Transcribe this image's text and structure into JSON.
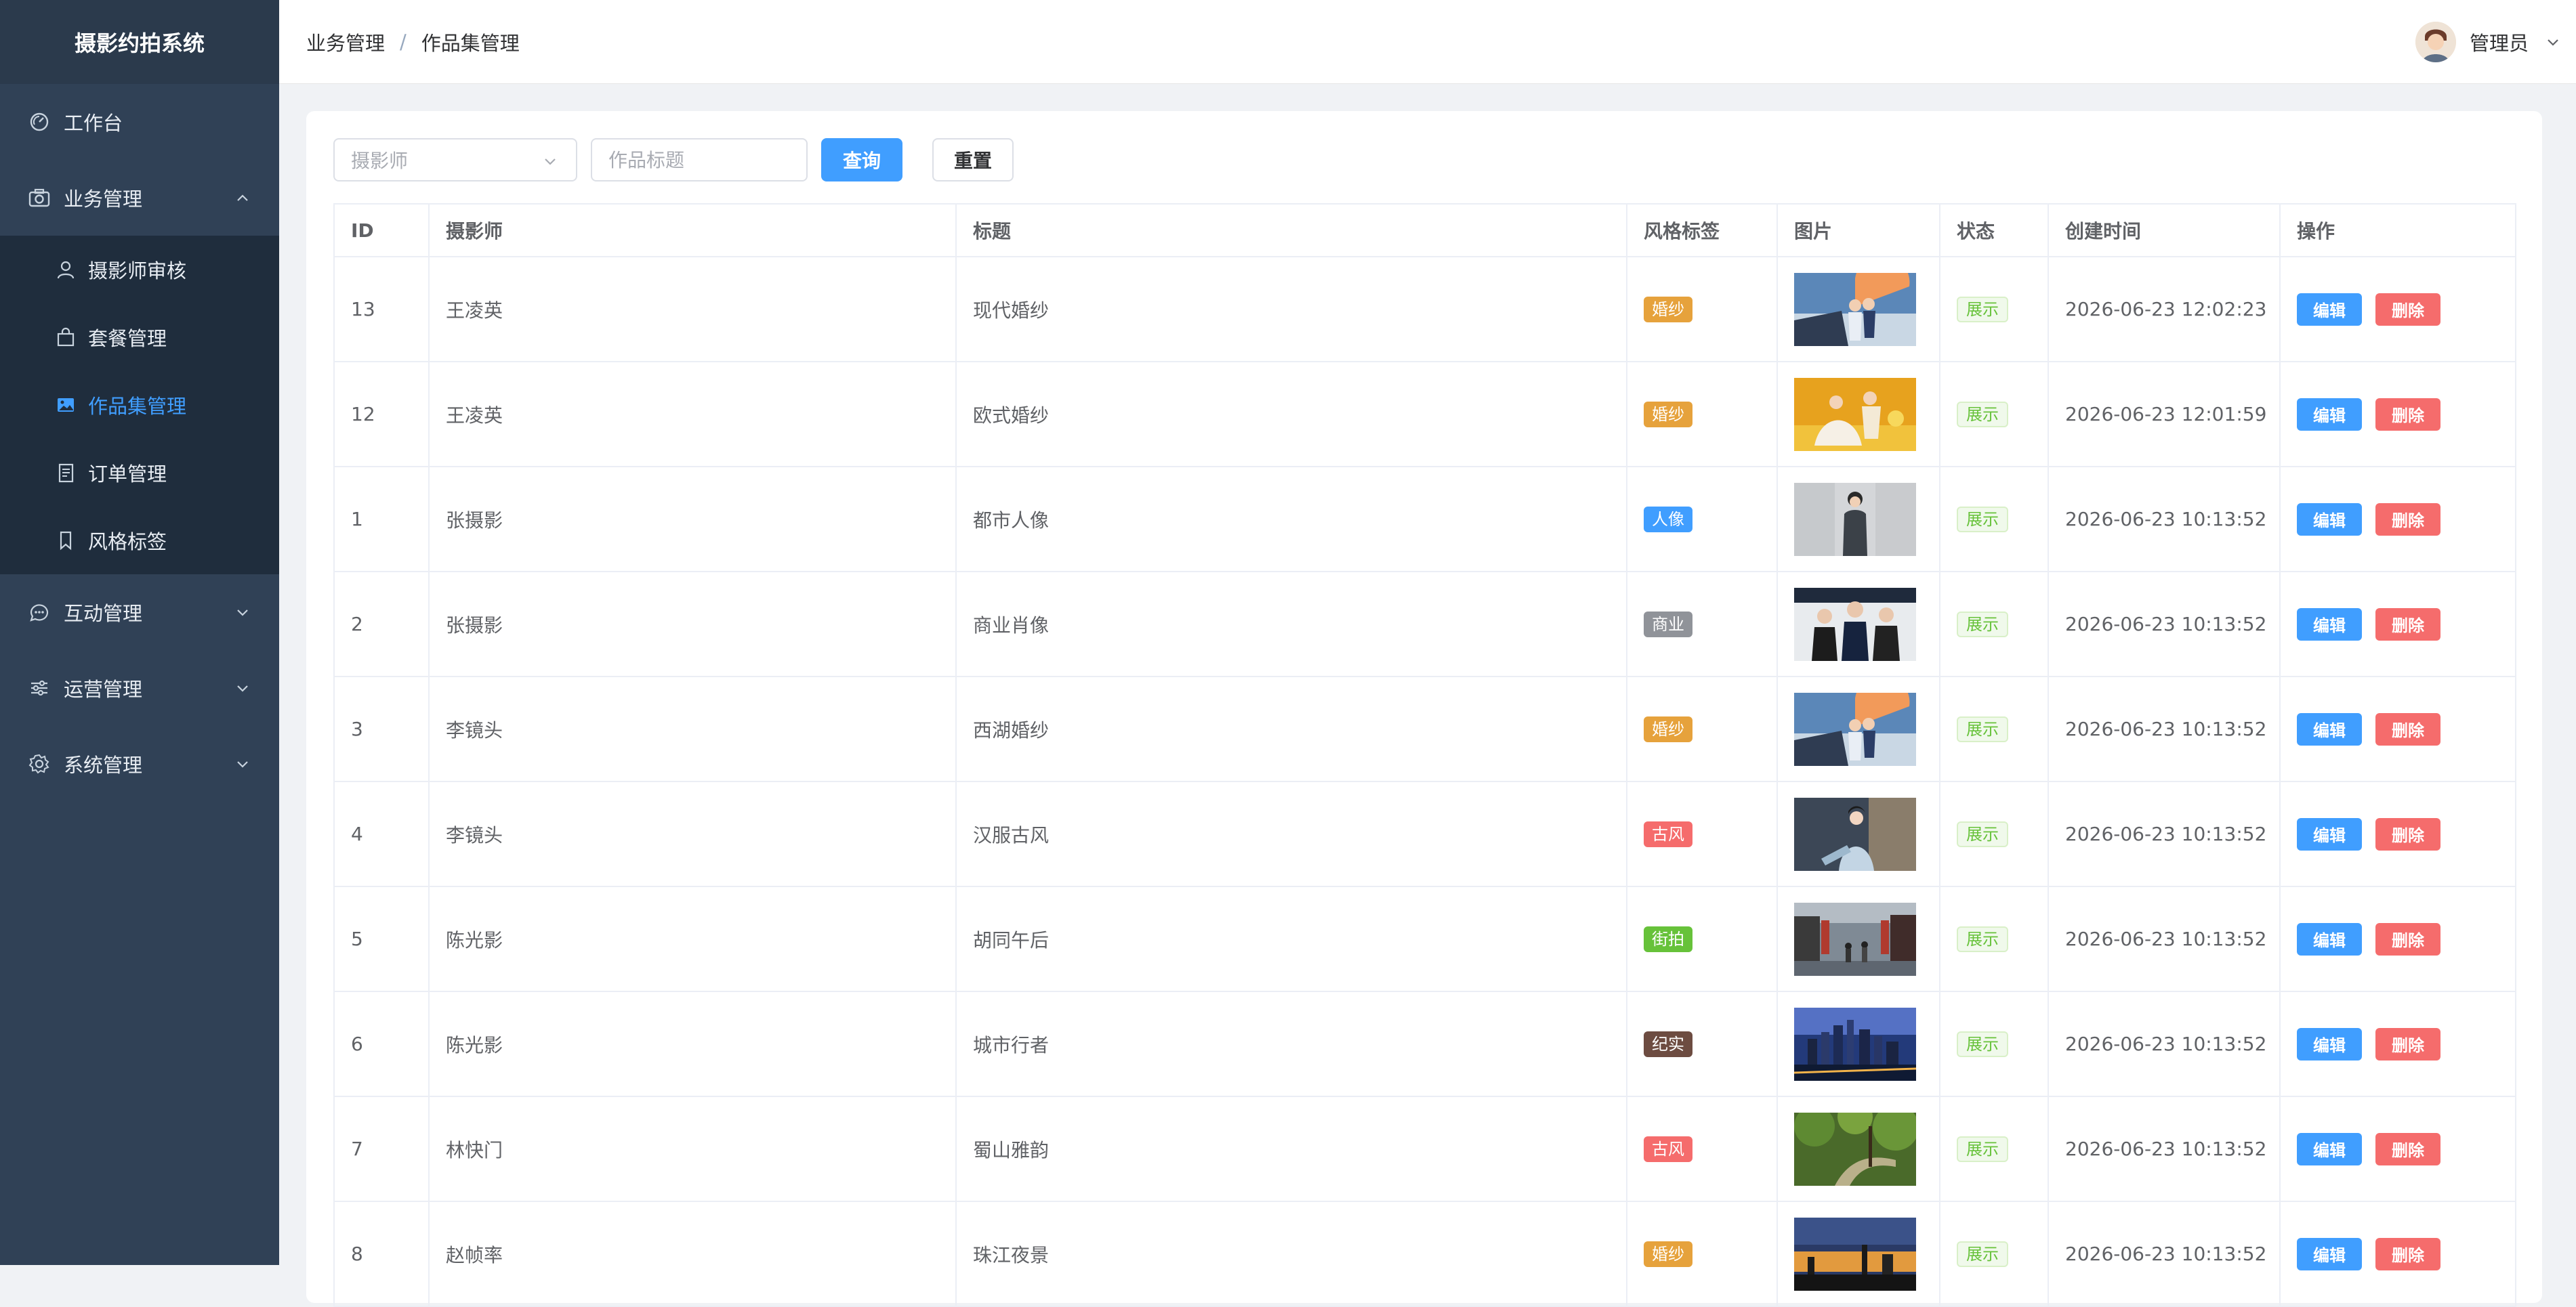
{
  "brand": "摄影约拍系统",
  "sidebar": {
    "workbench": "工作台",
    "business": {
      "label": "业务管理",
      "items": [
        {
          "label": "摄影师审核",
          "icon": "user-icon"
        },
        {
          "label": "套餐管理",
          "icon": "bag-icon"
        },
        {
          "label": "作品集管理",
          "icon": "image-icon",
          "active": true
        },
        {
          "label": "订单管理",
          "icon": "document-icon"
        },
        {
          "label": "风格标签",
          "icon": "bookmark-icon"
        }
      ]
    },
    "interaction": "互动管理",
    "operations": "运营管理",
    "system": "系统管理"
  },
  "header": {
    "breadcrumb": [
      "业务管理",
      "作品集管理"
    ],
    "breadcrumb_sep": "/",
    "user": "管理员"
  },
  "filters": {
    "photographer_placeholder": "摄影师",
    "title_placeholder": "作品标题",
    "query_label": "查询",
    "reset_label": "重置"
  },
  "table": {
    "columns": [
      "ID",
      "摄影师",
      "标题",
      "风格标签",
      "图片",
      "状态",
      "创建时间",
      "操作"
    ],
    "edit_label": "编辑",
    "delete_label": "删除",
    "rows": [
      {
        "id": "13",
        "photographer": "王凌英",
        "title": "现代婚纱",
        "tag": "婚纱",
        "tag_color": "#e6a23c",
        "status": "展示",
        "created": "2026-06-23 12:02:23",
        "img": "wedding-beach"
      },
      {
        "id": "12",
        "photographer": "王凌英",
        "title": "欧式婚纱",
        "tag": "婚纱",
        "tag_color": "#e6a23c",
        "status": "展示",
        "created": "2026-06-23 12:01:59",
        "img": "wedding-yellow"
      },
      {
        "id": "1",
        "photographer": "张摄影",
        "title": "都市人像",
        "tag": "人像",
        "tag_color": "#409eff",
        "status": "展示",
        "created": "2026-06-23 10:13:52",
        "img": "portrait"
      },
      {
        "id": "2",
        "photographer": "张摄影",
        "title": "商业肖像",
        "tag": "商业",
        "tag_color": "#909399",
        "status": "展示",
        "created": "2026-06-23 10:13:52",
        "img": "business"
      },
      {
        "id": "3",
        "photographer": "李镜头",
        "title": "西湖婚纱",
        "tag": "婚纱",
        "tag_color": "#e6a23c",
        "status": "展示",
        "created": "2026-06-23 10:13:52",
        "img": "wedding-beach"
      },
      {
        "id": "4",
        "photographer": "李镜头",
        "title": "汉服古风",
        "tag": "古风",
        "tag_color": "#f56c6c",
        "status": "展示",
        "created": "2026-06-23 10:13:52",
        "img": "hanfu"
      },
      {
        "id": "5",
        "photographer": "陈光影",
        "title": "胡同午后",
        "tag": "街拍",
        "tag_color": "#67c23a",
        "status": "展示",
        "created": "2026-06-23 10:13:52",
        "img": "street"
      },
      {
        "id": "6",
        "photographer": "陈光影",
        "title": "城市行者",
        "tag": "纪实",
        "tag_color": "#6d4c41",
        "status": "展示",
        "created": "2026-06-23 10:13:52",
        "img": "city"
      },
      {
        "id": "7",
        "photographer": "林快门",
        "title": "蜀山雅韵",
        "tag": "古风",
        "tag_color": "#f56c6c",
        "status": "展示",
        "created": "2026-06-23 10:13:52",
        "img": "forest"
      },
      {
        "id": "8",
        "photographer": "赵帧率",
        "title": "珠江夜景",
        "tag": "婚纱",
        "tag_color": "#e6a23c",
        "status": "展示",
        "created": "2026-06-23 10:13:52",
        "img": "sunset"
      }
    ]
  }
}
